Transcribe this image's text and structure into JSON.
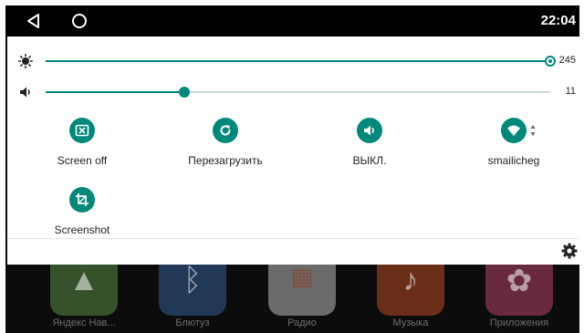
{
  "status_bar": {
    "time": "22:04"
  },
  "sliders": {
    "brightness": {
      "icon": "brightness-icon",
      "value": "245",
      "fraction": 1.0
    },
    "volume": {
      "icon": "volume-icon",
      "value": "11",
      "fraction": 0.275
    }
  },
  "tiles": [
    {
      "label": "Screen off",
      "icon": "screen-off-icon"
    },
    {
      "label": "Перезагрузить",
      "icon": "restart-icon"
    },
    {
      "label": "ВЫКЛ.",
      "icon": "volume-icon"
    },
    {
      "label": "smailicheg",
      "icon": "wifi-icon"
    },
    {
      "label": "Screenshot",
      "icon": "crop-icon"
    }
  ],
  "home_apps": [
    {
      "label": "Яндекс Нав...",
      "icon": "navigator-icon",
      "color": "#6aa84f"
    },
    {
      "label": "Блютуз",
      "icon": "bluetooth-icon",
      "color": "#3d6fb3"
    },
    {
      "label": "Радио",
      "icon": "radio-icon",
      "color": "#e0e0e0"
    },
    {
      "label": "Музыка",
      "icon": "music-icon",
      "color": "#e05a2b"
    },
    {
      "label": "Приложения",
      "icon": "apps-icon",
      "color": "#d94f78"
    }
  ],
  "colors": {
    "accent": "#00897b"
  }
}
